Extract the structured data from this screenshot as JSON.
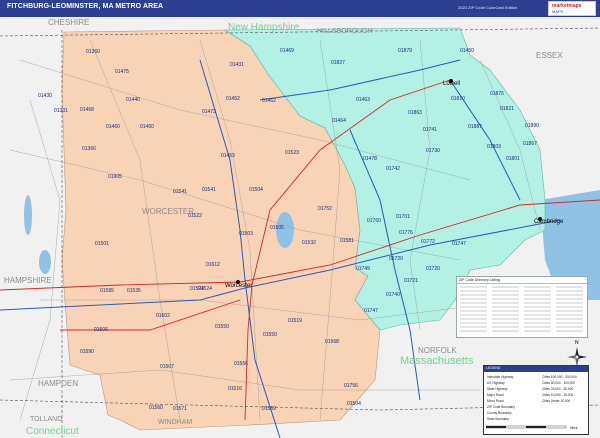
{
  "header": {
    "title": "FITCHBURG-LEOMINSTER, MA METRO AREA",
    "edition": "2023 ZIP Code ColorCast Edition"
  },
  "logo": {
    "line1": "marketmaps",
    "line2": "MAPS"
  },
  "colors": {
    "header": "#2d3f8e",
    "worcester_fill": "#f9d3b6",
    "middlesex_fill": "#b2f1e4",
    "outside_fill": "#f1f1f1",
    "water": "#8fc2e5",
    "highway_red": "#d62828",
    "highway_blue": "#2d5bb0",
    "road_grey": "#9a9a9a",
    "state_label": "#6fd28e"
  },
  "region_labels": [
    {
      "text": "CHESHIRE",
      "kind": "county"
    },
    {
      "text": "HILLSBOROUGH",
      "kind": "county"
    },
    {
      "text": "ESSEX",
      "kind": "county"
    },
    {
      "text": "WORCESTER",
      "kind": "county"
    },
    {
      "text": "HAMPSHIRE",
      "kind": "county"
    },
    {
      "text": "HAMPDEN",
      "kind": "county"
    },
    {
      "text": "NORFOLK",
      "kind": "county"
    },
    {
      "text": "TOLLAND",
      "kind": "county"
    },
    {
      "text": "WINDHAM",
      "kind": "county"
    },
    {
      "text": "New Hampshire",
      "kind": "state"
    },
    {
      "text": "Massachusetts",
      "kind": "state"
    },
    {
      "text": "Connecticut",
      "kind": "state"
    }
  ],
  "cities": [
    {
      "text": "Worcester"
    },
    {
      "text": "Lowell"
    },
    {
      "text": "Cambridge"
    }
  ],
  "zip_labels": [
    "01360",
    "01469",
    "01450",
    "01827",
    "01475",
    "01431",
    "01430",
    "01462",
    "01440",
    "01473",
    "01452",
    "01468",
    "01541",
    "01504",
    "01453",
    "01460",
    "01523",
    "01464",
    "01331",
    "01366",
    "01905",
    "01541",
    "01522",
    "01503",
    "01505",
    "01501",
    "01612",
    "01524",
    "01585",
    "01535",
    "01606",
    "01602",
    "01550",
    "01550",
    "01524",
    "01519",
    "01560",
    "01568",
    "01566",
    "01507",
    "01571",
    "01516",
    "01569",
    "01504",
    "01756",
    "01747",
    "01740",
    "01720",
    "01776",
    "01742",
    "01741",
    "01863",
    "01879",
    "01730",
    "01801",
    "01803",
    "01887",
    "01721",
    "01749",
    "01752",
    "01810",
    "01821",
    "01876",
    "01890",
    "01867",
    "01463",
    "01532",
    "01581",
    "01772",
    "01760",
    "01701",
    "01720",
    "01478",
    "01460",
    "01590",
    "01747"
  ],
  "legend_table": {
    "header": "ZIP Code Directory Listing"
  },
  "legend_box": {
    "header": "LEGEND",
    "rows": [
      "Interstate Highway",
      "US Highway",
      "State Highway",
      "Major Road",
      "Minor Road",
      "ZIP Code Boundary",
      "County Boundary",
      "State Boundary"
    ],
    "city_sizes": [
      "Cities 100,000 - 500,000",
      "Cities 50,000 - 100,000",
      "Cities 25,000 - 50,000",
      "Cities 10,000 - 25,000",
      "Cities Under 10,000"
    ]
  },
  "scale_label": "Miles",
  "compass": "N"
}
